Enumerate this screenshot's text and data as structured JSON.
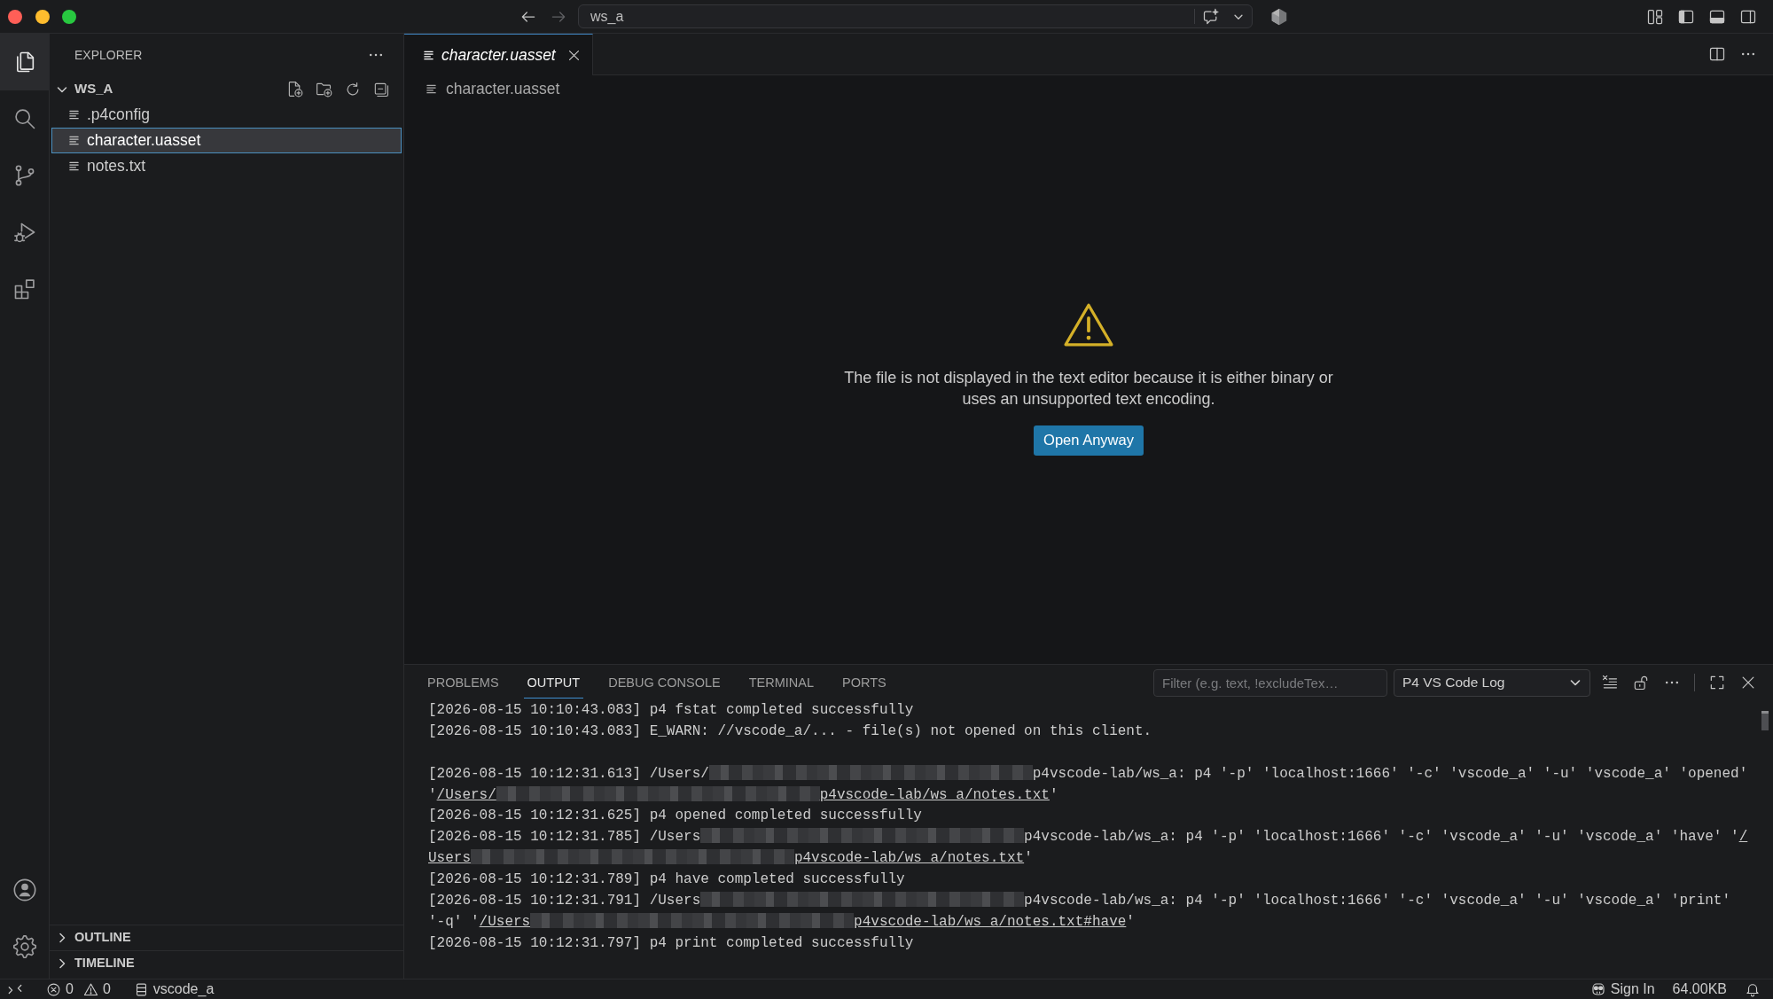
{
  "title_bar": {
    "navigation": [
      {
        "kind": "back",
        "disabled": false
      },
      {
        "kind": "forward",
        "disabled": true
      }
    ],
    "command_center": {
      "text": "ws_a"
    },
    "layout_toggles": [
      {
        "kind": "primary_sidebar",
        "on": true
      },
      {
        "kind": "panel",
        "on": true
      },
      {
        "kind": "secondary_sidebar",
        "on": false
      }
    ]
  },
  "activity_bar": {
    "items": [
      {
        "kind": "explorer",
        "selected": true
      },
      {
        "kind": "search",
        "selected": false
      },
      {
        "kind": "source_control",
        "selected": false
      },
      {
        "kind": "run_debug",
        "selected": false
      },
      {
        "kind": "extensions",
        "selected": false
      }
    ],
    "bottom_items": [
      {
        "kind": "account"
      },
      {
        "kind": "settings"
      }
    ]
  },
  "sidebar": {
    "title": "EXPLORER",
    "folder": {
      "name": "WS_A",
      "expanded": true,
      "children": [
        {
          "name": ".p4config",
          "selected": false
        },
        {
          "name": "character.uasset",
          "selected": true
        },
        {
          "name": "notes.txt",
          "selected": false
        }
      ]
    },
    "sections": [
      {
        "title": "OUTLINE",
        "expanded": false
      },
      {
        "title": "TIMELINE",
        "expanded": false
      }
    ]
  },
  "editor": {
    "tabs": [
      {
        "label": "character.uasset",
        "selected": true,
        "preview": true
      }
    ],
    "breadcrumb": [
      "character.uasset"
    ],
    "notice": {
      "message_lines": [
        "The file is not displayed in the text editor because it is either binary or",
        "uses an unsupported text encoding."
      ],
      "button": "Open Anyway"
    }
  },
  "panel": {
    "tabs": [
      {
        "label": "PROBLEMS",
        "selected": false
      },
      {
        "label": "OUTPUT",
        "selected": true
      },
      {
        "label": "DEBUG CONSOLE",
        "selected": false
      },
      {
        "label": "TERMINAL",
        "selected": false
      },
      {
        "label": "PORTS",
        "selected": false
      }
    ],
    "filter": {
      "placeholder": "Filter (e.g. text, !excludeTex…"
    },
    "channel": "P4 VS Code Log",
    "log": [
      {
        "kind": "entry",
        "segments": [
          {
            "kind": "text",
            "text": "[2026-08-15 10:10:43.083] p4 fstat completed successfully"
          }
        ]
      },
      {
        "kind": "entry",
        "segments": [
          {
            "kind": "text",
            "text": "[2026-08-15 10:10:43.083] E_WARN: //vscode_a/... - file(s) not opened on this client."
          }
        ]
      },
      {
        "kind": "blank"
      },
      {
        "kind": "entry",
        "segments": [
          {
            "kind": "text",
            "text": "[2026-08-15 10:12:31.613] /Users/"
          },
          {
            "kind": "redacted"
          },
          {
            "kind": "text",
            "text": "p4vscode-lab/ws_a: p4 '-p' 'localhost:1666' '-c' 'vscode_a' '-u' 'vscode_a' 'opened'"
          }
        ]
      },
      {
        "kind": "entry",
        "segments": [
          {
            "kind": "text",
            "text": "'"
          },
          {
            "kind": "link",
            "text": "/Users/"
          },
          {
            "kind": "redacted"
          },
          {
            "kind": "link",
            "text": "p4vscode-lab/ws_a/notes.txt"
          },
          {
            "kind": "text",
            "text": "'"
          }
        ]
      },
      {
        "kind": "entry",
        "segments": [
          {
            "kind": "text",
            "text": "[2026-08-15 10:12:31.625] p4 opened completed successfully"
          }
        ]
      },
      {
        "kind": "entry",
        "segments": [
          {
            "kind": "text",
            "text": "[2026-08-15 10:12:31.785] /Users"
          },
          {
            "kind": "redacted"
          },
          {
            "kind": "text",
            "text": "p4vscode-lab/ws_a: p4 '-p' 'localhost:1666' '-c' 'vscode_a' '-u' 'vscode_a' 'have' '"
          },
          {
            "kind": "link",
            "text": "/"
          }
        ]
      },
      {
        "kind": "entry",
        "segments": [
          {
            "kind": "link",
            "text": "Users"
          },
          {
            "kind": "redacted"
          },
          {
            "kind": "link",
            "text": "p4vscode-lab/ws_a/notes.txt"
          },
          {
            "kind": "text",
            "text": "'"
          }
        ]
      },
      {
        "kind": "entry",
        "segments": [
          {
            "kind": "text",
            "text": "[2026-08-15 10:12:31.789] p4 have completed successfully"
          }
        ]
      },
      {
        "kind": "entry",
        "segments": [
          {
            "kind": "text",
            "text": "[2026-08-15 10:12:31.791] /Users"
          },
          {
            "kind": "redacted"
          },
          {
            "kind": "text",
            "text": "p4vscode-lab/ws_a: p4 '-p' 'localhost:1666' '-c' 'vscode_a' '-u' 'vscode_a' 'print'"
          }
        ]
      },
      {
        "kind": "entry",
        "segments": [
          {
            "kind": "text",
            "text": "'-q' '"
          },
          {
            "kind": "link",
            "text": "/Users"
          },
          {
            "kind": "redacted"
          },
          {
            "kind": "link",
            "text": "p4vscode-lab/ws_a/notes.txt#have"
          },
          {
            "kind": "text",
            "text": "'"
          }
        ]
      },
      {
        "kind": "entry",
        "segments": [
          {
            "kind": "text",
            "text": "[2026-08-15 10:12:31.797] p4 print completed successfully"
          }
        ]
      }
    ]
  },
  "status_bar": {
    "errors": "0",
    "warnings": "0",
    "workspace": "vscode_a",
    "sign_in": "Sign In",
    "size": "64.00KB"
  }
}
